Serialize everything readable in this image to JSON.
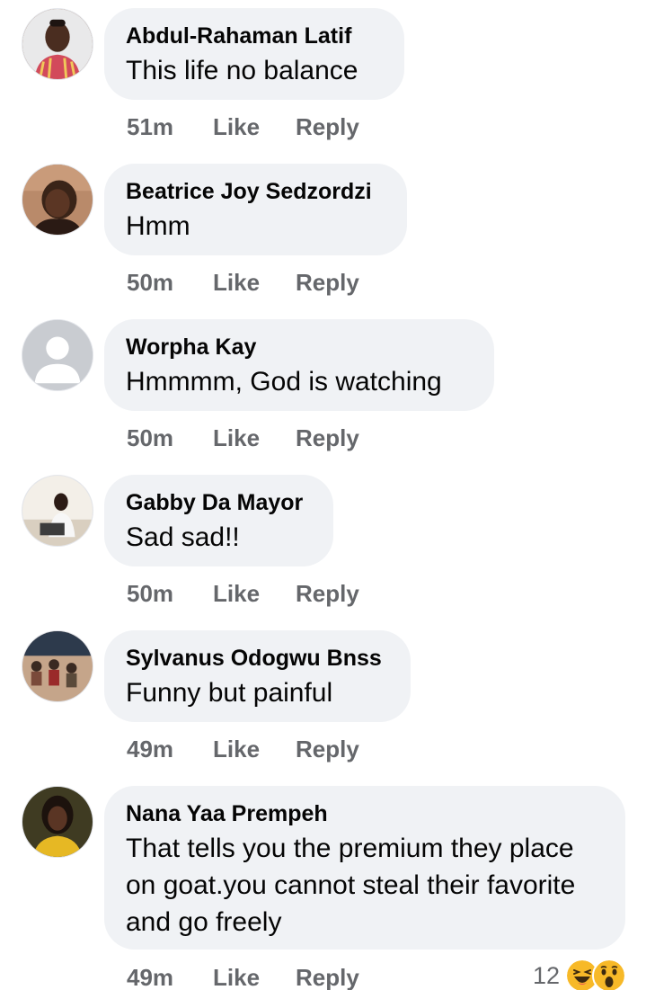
{
  "comments": [
    {
      "author": "Abdul-Rahaman Latif",
      "text": "This life no balance",
      "time": "51m",
      "like": "Like",
      "reply": "Reply",
      "avatar_icon": "person-photo-avatar"
    },
    {
      "author": "Beatrice Joy Sedzordzi",
      "text": "Hmm",
      "time": "50m",
      "like": "Like",
      "reply": "Reply",
      "avatar_icon": "person-photo-avatar"
    },
    {
      "author": "Worpha Kay",
      "text": "Hmmmm, God is watching",
      "time": "50m",
      "like": "Like",
      "reply": "Reply",
      "avatar_icon": "default-profile-avatar"
    },
    {
      "author": "Gabby Da Mayor",
      "text": "Sad sad!!",
      "time": "50m",
      "like": "Like",
      "reply": "Reply",
      "avatar_icon": "person-photo-avatar"
    },
    {
      "author": "Sylvanus Odogwu Bnss",
      "text": "Funny but painful",
      "time": "49m",
      "like": "Like",
      "reply": "Reply",
      "avatar_icon": "group-photo-avatar"
    },
    {
      "author": "Nana Yaa Prempeh",
      "text": "That tells you the premium they place on goat.you cannot steal their favorite and go freely",
      "time": "49m",
      "like": "Like",
      "reply": "Reply",
      "avatar_icon": "person-photo-avatar",
      "reaction_count": "12",
      "reactions": [
        "haha-emoji-icon",
        "wow-emoji-icon"
      ]
    }
  ],
  "colors": {
    "bubble": "#f0f2f5",
    "meta": "#65676b",
    "text": "#050505",
    "emoji": "#f7b928"
  }
}
